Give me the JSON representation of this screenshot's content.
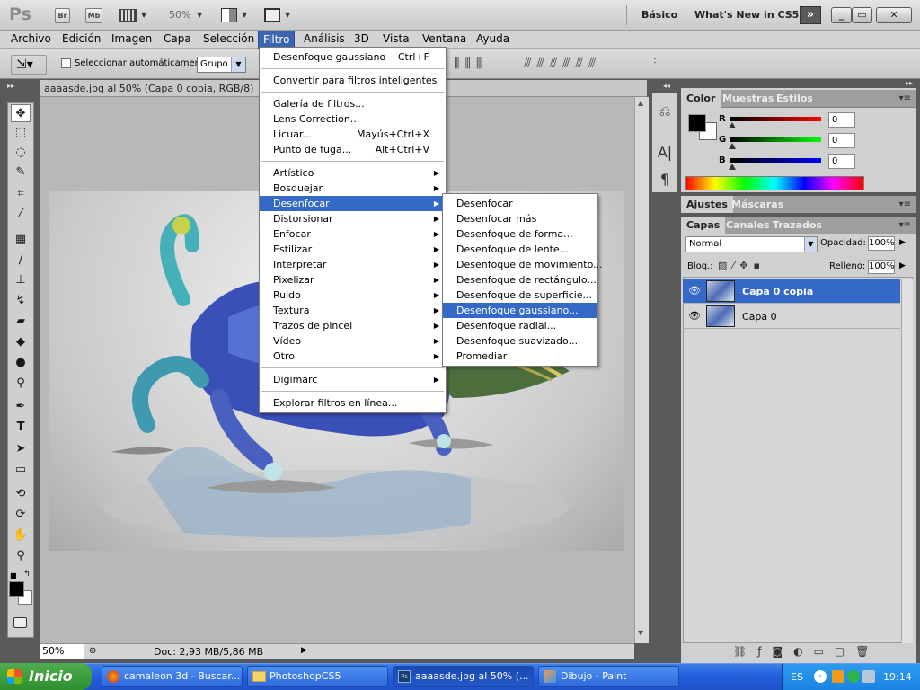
{
  "app": {
    "logo": "Ps",
    "br_label": "Br",
    "mb_label": "Mb",
    "zoom": "50%"
  },
  "workspace": {
    "basic": "Básico",
    "whats_new": "What's New in CS5"
  },
  "menubar": [
    "Archivo",
    "Edición",
    "Imagen",
    "Capa",
    "Selección",
    "Filtro",
    "Análisis",
    "3D",
    "Vista",
    "Ventana",
    "Ayuda"
  ],
  "options": {
    "auto_select_label": "Seleccionar automáticamente:",
    "auto_select_value": "Grupo"
  },
  "document": {
    "tab_title": "aaaasde.jpg al 50% (Capa 0 copia, RGB/8)",
    "status_zoom": "50%",
    "doc_size": "Doc: 2,93 MB/5,86 MB"
  },
  "filter_menu": {
    "top": [
      {
        "label": "Desenfoque gaussiano",
        "shortcut": "Ctrl+F"
      },
      {
        "label": "Convertir para filtros inteligentes",
        "shortcut": ""
      },
      {
        "label": "Galería de filtros...",
        "shortcut": ""
      },
      {
        "label": "Lens Correction...",
        "shortcut": ""
      },
      {
        "label": "Licuar...",
        "shortcut": "Mayús+Ctrl+X"
      },
      {
        "label": "Punto de fuga...",
        "shortcut": "Alt+Ctrl+V"
      }
    ],
    "groups": [
      "Artístico",
      "Bosquejar",
      "Desenfocar",
      "Distorsionar",
      "Enfocar",
      "Estilizar",
      "Interpretar",
      "Pixelizar",
      "Ruido",
      "Textura",
      "Trazos de pincel",
      "Vídeo",
      "Otro"
    ],
    "digimarc": "Digimarc",
    "browse": "Explorar filtros en línea..."
  },
  "blur_submenu": [
    "Desenfocar",
    "Desenfocar más",
    "Desenfoque de forma...",
    "Desenfoque de lente...",
    "Desenfoque de movimiento...",
    "Desenfoque de rectángulo...",
    "Desenfoque de superficie...",
    "Desenfoque gaussiano...",
    "Desenfoque radial...",
    "Desenfoque suavizado...",
    "Promediar"
  ],
  "color_panel": {
    "tabs": [
      "Color",
      "Muestras",
      "Estilos"
    ],
    "r_label": "R",
    "g_label": "G",
    "b_label": "B",
    "r": "0",
    "g": "0",
    "b": "0"
  },
  "adjust_tabs": [
    "Ajustes",
    "Máscaras"
  ],
  "layers_panel": {
    "tabs": [
      "Capas",
      "Canales",
      "Trazados"
    ],
    "blend_mode": "Normal",
    "opacity_label": "Opacidad:",
    "opacity": "100%",
    "lock_label": "Bloq.:",
    "fill_label": "Relleno:",
    "fill": "100%",
    "layers": [
      {
        "name": "Capa 0 copia",
        "selected": true
      },
      {
        "name": "Capa 0",
        "selected": false
      }
    ]
  },
  "taskbar": {
    "start": "Inicio",
    "tasks": [
      "camaleon 3d - Buscar...",
      "PhotoshopCS5",
      "aaaasde.jpg al 50% (...",
      "Dibujo - Paint"
    ],
    "lang": "ES",
    "clock": "19:14"
  },
  "colors": {
    "highlight": "#3569c7",
    "ui_gray": "#d0d0d0",
    "taskbar": "#245edb",
    "start": "#2e8f2e"
  }
}
